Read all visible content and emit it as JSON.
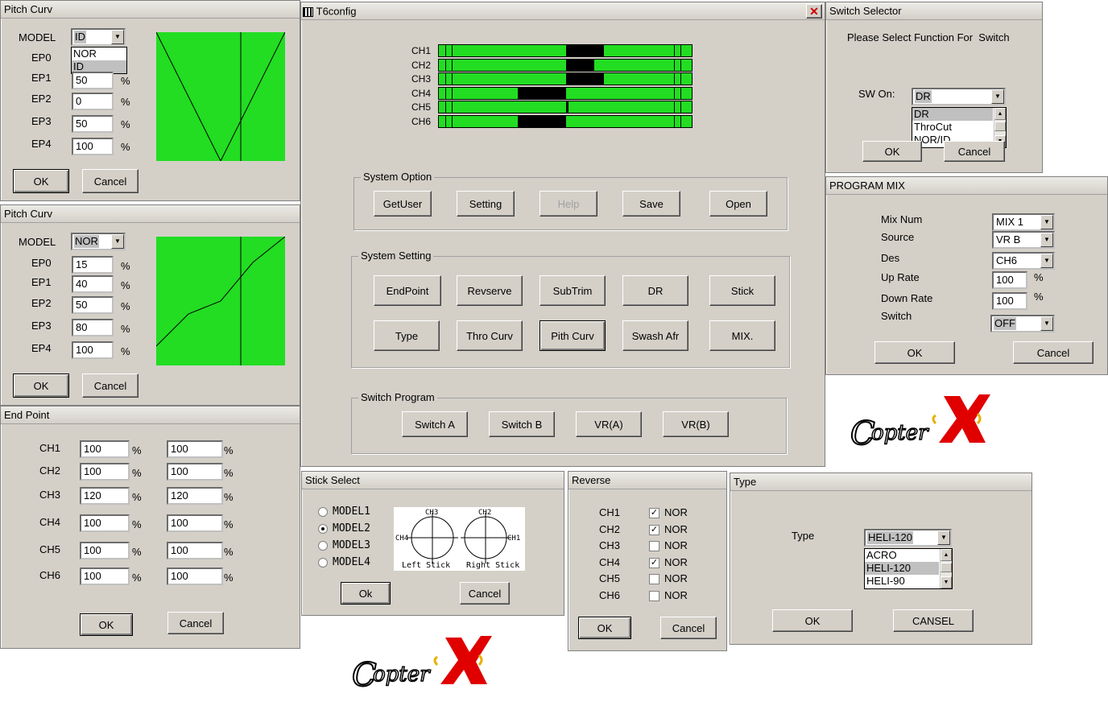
{
  "pitch1": {
    "title": "Pitch Curv",
    "model_label": "MODEL",
    "model_value": "ID",
    "options": [
      "NOR",
      "ID"
    ],
    "ep": [
      {
        "label": "EP0",
        "value": ""
      },
      {
        "label": "EP1",
        "value": "50"
      },
      {
        "label": "EP2",
        "value": "0"
      },
      {
        "label": "EP3",
        "value": "50"
      },
      {
        "label": "EP4",
        "value": "100"
      }
    ],
    "unit": "%",
    "ok": "OK",
    "cancel": "Cancel"
  },
  "pitch2": {
    "title": "Pitch Curv",
    "model_label": "MODEL",
    "model_value": "NOR",
    "ep": [
      {
        "label": "EP0",
        "value": "15"
      },
      {
        "label": "EP1",
        "value": "40"
      },
      {
        "label": "EP2",
        "value": "50"
      },
      {
        "label": "EP3",
        "value": "80"
      },
      {
        "label": "EP4",
        "value": "100"
      }
    ],
    "unit": "%",
    "ok": "OK",
    "cancel": "Cancel"
  },
  "endpoint": {
    "title": "End Point",
    "unit": "%",
    "ok": "OK",
    "cancel": "Cancel",
    "rows": [
      {
        "ch": "CH1",
        "a": "100",
        "b": "100"
      },
      {
        "ch": "CH2",
        "a": "100",
        "b": "100"
      },
      {
        "ch": "CH3",
        "a": "120",
        "b": "120"
      },
      {
        "ch": "CH4",
        "a": "100",
        "b": "100"
      },
      {
        "ch": "CH5",
        "a": "100",
        "b": "100"
      },
      {
        "ch": "CH6",
        "a": "100",
        "b": "100"
      }
    ]
  },
  "main": {
    "title": "T6config",
    "channels": [
      {
        "name": "CH1",
        "from": 0.5,
        "to": 0.65
      },
      {
        "name": "CH2",
        "from": 0.5,
        "to": 0.61
      },
      {
        "name": "CH3",
        "from": 0.5,
        "to": 0.65
      },
      {
        "name": "CH4",
        "from": 0.31,
        "to": 0.5
      },
      {
        "name": "CH5",
        "from": 0.5,
        "to": 0.51
      },
      {
        "name": "CH6",
        "from": 0.31,
        "to": 0.5
      }
    ],
    "system_option": {
      "title": "System Option",
      "buttons": [
        "GetUser",
        "Setting",
        "Help",
        "Save",
        "Open"
      ]
    },
    "system_setting": {
      "title": "System Setting",
      "row1": [
        "EndPoint",
        "Revserve",
        "SubTrim",
        "DR",
        "Stick"
      ],
      "row2": [
        "Type",
        "Thro Curv",
        "Pith Curv",
        "Swash Afr",
        "MIX."
      ]
    },
    "switch_program": {
      "title": "Switch Program",
      "buttons": [
        "Switch A",
        "Switch B",
        "VR(A)",
        "VR(B)"
      ]
    }
  },
  "switch_selector": {
    "title": "Switch Selector",
    "prompt": "Please Select Function For  Switch",
    "sw_label": "SW On:",
    "sw_value": "DR",
    "options": [
      "DR",
      "ThroCut",
      "NOR/ID"
    ],
    "ok": "OK",
    "cancel": "Cancel"
  },
  "program_mix": {
    "title": "PROGRAM MIX",
    "rows": [
      {
        "label": "Mix Num",
        "value": "MIX 1"
      },
      {
        "label": "Source",
        "value": "VR B"
      },
      {
        "label": "Des",
        "value": "CH6"
      }
    ],
    "up_label": "Up Rate",
    "up_value": "100",
    "down_label": "Down Rate",
    "down_value": "100",
    "switch_label": "Switch",
    "switch_value": "OFF",
    "unit": "%",
    "ok": "OK",
    "cancel": "Cancel"
  },
  "stick_select": {
    "title": "Stick Select",
    "models": [
      "MODEL1",
      "MODEL2",
      "MODEL3",
      "MODEL4"
    ],
    "selected": 1,
    "ch_top_left": "CH3",
    "ch_left": "CH4",
    "ch_top_right": "CH2",
    "ch_right": "CH1",
    "left_caption": "Left Stick",
    "right_caption": "Right Stick",
    "ok": "Ok",
    "cancel": "Cancel"
  },
  "reverse": {
    "title": "Reverse",
    "rows": [
      {
        "ch": "CH1",
        "checked": true,
        "label": "NOR"
      },
      {
        "ch": "CH2",
        "checked": true,
        "label": "NOR"
      },
      {
        "ch": "CH3",
        "checked": false,
        "label": "NOR"
      },
      {
        "ch": "CH4",
        "checked": true,
        "label": "NOR"
      },
      {
        "ch": "CH5",
        "checked": false,
        "label": "NOR"
      },
      {
        "ch": "CH6",
        "checked": false,
        "label": "NOR"
      }
    ],
    "ok": "OK",
    "cancel": "Cancel"
  },
  "type": {
    "title": "Type",
    "label": "Type",
    "value": "HELI-120",
    "options": [
      "ACRO",
      "HELI-120",
      "HELI-90"
    ],
    "ok": "OK",
    "cancel": "CANSEL"
  },
  "colors": {
    "curve_bg": "#22dd22",
    "bar_bg": "#22dd22",
    "window_bg": "#d4d0c8"
  }
}
